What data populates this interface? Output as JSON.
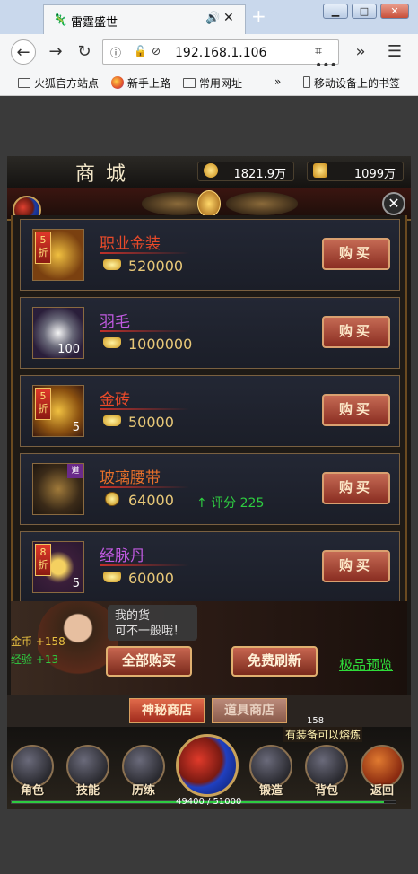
{
  "browser": {
    "tab_title": "雷霆盛世",
    "url": "192.168.1.106",
    "bookmarks": [
      "火狐官方站点",
      "新手上路",
      "常用网址",
      "移动设备上的书签"
    ]
  },
  "shop": {
    "title": "商城",
    "currency_gold": "1821.9万",
    "currency_ingot": "1099万",
    "items": [
      {
        "name": "职业金装",
        "price": "520000",
        "name_color": "#e84a2a",
        "discount": "5\n折",
        "count": "",
        "tag": "",
        "currency": "ingot",
        "score": ""
      },
      {
        "name": "羽毛",
        "price": "1000000",
        "name_color": "#c05ae0",
        "discount": "",
        "count": "100",
        "tag": "",
        "currency": "ingot",
        "score": ""
      },
      {
        "name": "金砖",
        "price": "50000",
        "name_color": "#e84a2a",
        "discount": "5\n折",
        "count": "5",
        "tag": "",
        "currency": "ingot",
        "score": ""
      },
      {
        "name": "玻璃腰带",
        "price": "64000",
        "name_color": "#e8702a",
        "discount": "",
        "count": "",
        "tag": "道",
        "currency": "coin",
        "score": "评分 225"
      },
      {
        "name": "经脉丹",
        "price": "60000",
        "name_color": "#c05ae0",
        "discount": "8\n折",
        "count": "5",
        "tag": "",
        "currency": "ingot",
        "score": ""
      }
    ],
    "buy_label": "购买",
    "npc_bubble": "我的货\n可不一般哦！",
    "side_gold": "金币 +158",
    "side_exp": "经验 +13",
    "buy_all_label": "全部购买",
    "free_refresh_label": "免费刷新",
    "premium_preview_label": "极品预览",
    "tabs": [
      "神秘商店",
      "道具商店"
    ]
  },
  "dock": {
    "buttons": [
      "角色",
      "技能",
      "历练",
      "锻造",
      "背包",
      "返回"
    ],
    "badge": "158",
    "equip_tip": "有装备可以熔炼",
    "xp_text": "49400 / 51000",
    "xp_fraction": 0.969
  },
  "colors": {
    "buy_button": "#a83a2a",
    "green": "#2ecc40",
    "gold": "#e8c878"
  }
}
